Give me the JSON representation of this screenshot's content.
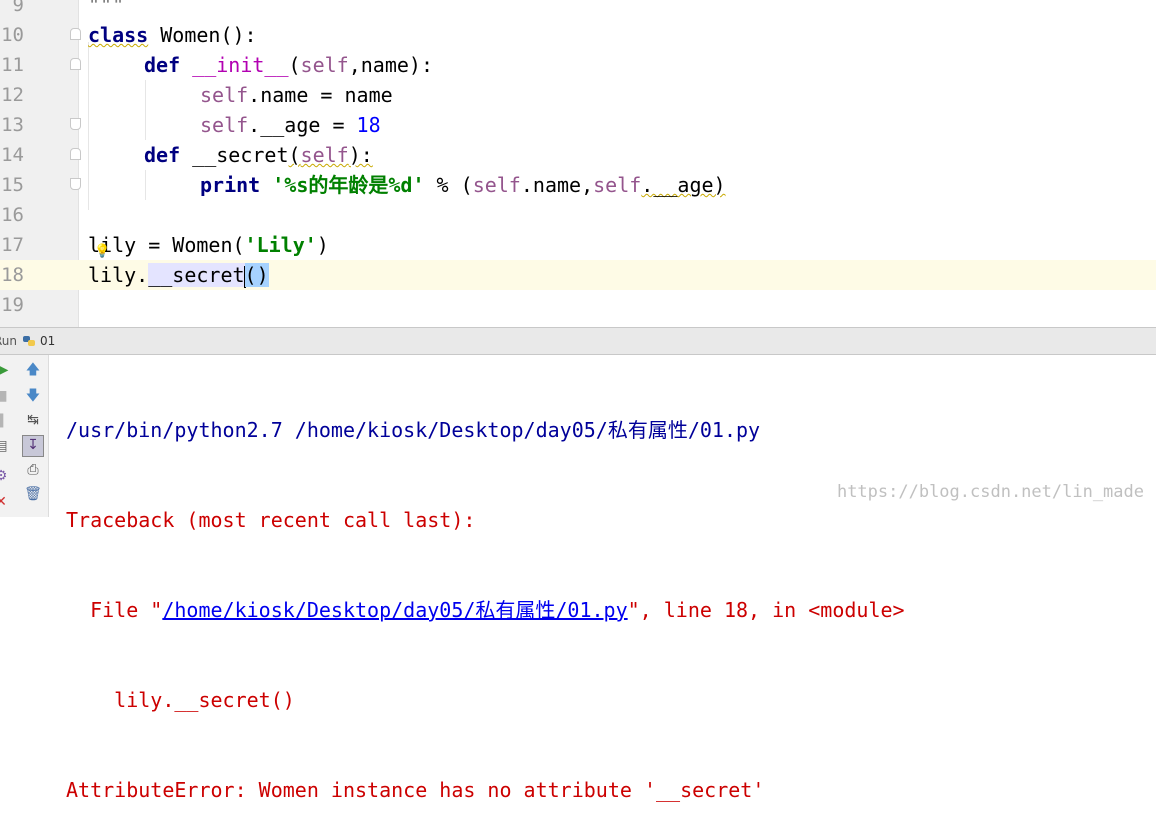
{
  "editor": {
    "lines": [
      {
        "num": "9"
      },
      {
        "num": "10"
      },
      {
        "num": "11"
      },
      {
        "num": "12"
      },
      {
        "num": "13"
      },
      {
        "num": "14"
      },
      {
        "num": "15"
      },
      {
        "num": "16"
      },
      {
        "num": "17"
      },
      {
        "num": "18"
      },
      {
        "num": "19"
      }
    ],
    "l9": "\"\"\"",
    "l10": {
      "kw": "class",
      "rest": " Women():"
    },
    "l11": {
      "kw": "def",
      "name": "__init__",
      "open": "(",
      "self": "self",
      "rest": ",name):"
    },
    "l12": {
      "self": "self",
      "rest": ".name = name"
    },
    "l13": {
      "self": "self",
      "rest": ".__age = ",
      "num": "18"
    },
    "l14": {
      "kw": "def",
      "name": " __secret",
      "open": "(",
      "self": "self",
      "rest": "):"
    },
    "l15": {
      "kw": "print",
      "str": "'%s的年龄是%d'",
      "rest": " % (",
      "self1": "self",
      "mid": ".name,",
      "self2": "self",
      "tail": ".__age)"
    },
    "l17": {
      "a": "lily = Women(",
      "str": "'Lily'",
      "b": ")"
    },
    "l18": {
      "a": "lily.",
      "name": "__secret",
      "sel": "()"
    }
  },
  "run": {
    "label": "Run",
    "config": "01"
  },
  "console": {
    "cmd": "/usr/bin/python2.7 /home/kiosk/Desktop/day05/私有属性/01.py",
    "tb": "Traceback (most recent call last):",
    "file_pre": "  File \"",
    "file_link": "/home/kiosk/Desktop/day05/私有属性/01.py",
    "file_post": "\", line 18, in <module>",
    "src": "    lily.__secret()",
    "error": "AttributeError: Women instance has no attribute '__secret'"
  },
  "watermark": "https://blog.csdn.net/lin_made",
  "colors": {
    "keyword": "#000080",
    "self": "#94558d",
    "string": "#008000",
    "error": "#cc0000",
    "current_line": "#fefbe6"
  }
}
